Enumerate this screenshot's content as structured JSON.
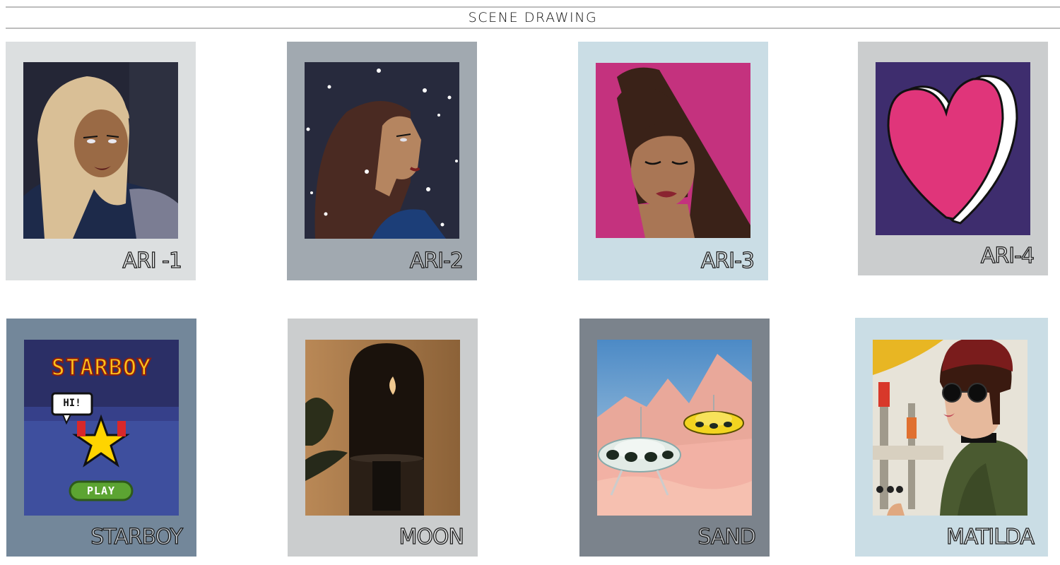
{
  "header": {
    "title": "SCENE DRAWING"
  },
  "cards": [
    {
      "caption": "ARI -1",
      "frame_color": "#dcdfe0",
      "art": "ari-blonde"
    },
    {
      "caption": "ARI-2",
      "frame_color": "#a1a9b0",
      "art": "ari-stars"
    },
    {
      "caption": "ARI-3",
      "frame_color": "#cadde5",
      "art": "ari-ponytail"
    },
    {
      "caption": "ARI-4",
      "frame_color": "#cbcdce",
      "art": "heart"
    },
    {
      "caption": "STARBOY",
      "frame_color": "#73879a",
      "art": "starboy-pixel",
      "art_text": {
        "title": "STARBOY",
        "bubble": "HI!",
        "button": "PLAY"
      }
    },
    {
      "caption": "MOON",
      "frame_color": "#cbcdce",
      "art": "moon-arch"
    },
    {
      "caption": "SAND",
      "frame_color": "#7b838c",
      "art": "sand-ufo"
    },
    {
      "caption": "MATILDA",
      "frame_color": "#cadde5",
      "art": "matilda-portrait"
    }
  ]
}
